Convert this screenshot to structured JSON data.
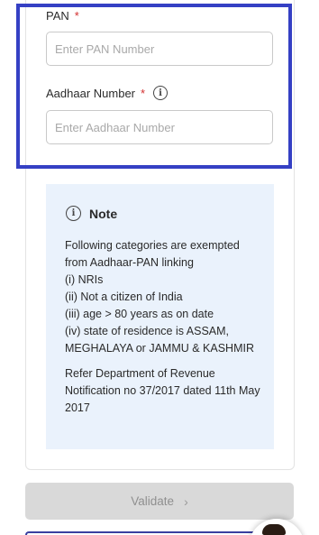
{
  "form": {
    "pan": {
      "label": "PAN",
      "required_mark": "*",
      "placeholder": "Enter PAN Number"
    },
    "aadhaar": {
      "label": "Aadhaar Number",
      "required_mark": "*",
      "info_icon": "info-icon",
      "placeholder": "Enter Aadhaar Number"
    }
  },
  "note": {
    "icon": "info-icon",
    "title": "Note",
    "lines": [
      "Following categories are exempted from Aadhaar-PAN linking",
      "(i) NRIs",
      "(ii) Not a citizen of India",
      "(iii) age > 80 years as on date",
      "(iv) state of residence is ASSAM, MEGHALAYA or JAMMU & KASHMIR"
    ],
    "reference": "Refer Department of Revenue Notification no 37/2017 dated 11th May 2017"
  },
  "actions": {
    "validate_label": "Validate",
    "validate_icon": "chevron-right-icon",
    "validate_enabled": false
  },
  "chat": {
    "icon": "chat-assistant-avatar"
  },
  "colors": {
    "highlight_border": "#3540c4",
    "required": "#d32f2f",
    "note_bg": "#eaf2fc",
    "disabled_button_bg": "#d9d9d9"
  }
}
